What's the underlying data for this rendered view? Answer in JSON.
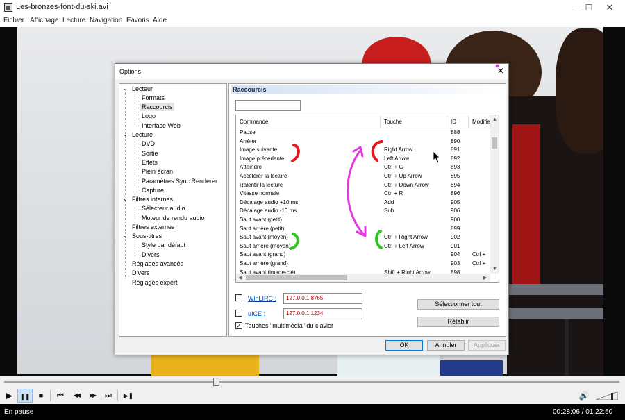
{
  "window": {
    "title": "Les-bronzes-font-du-ski.avi",
    "minimize": "–",
    "maximize": "☐",
    "close": "✕"
  },
  "menu": [
    "Fichier",
    "Affichage",
    "Lecture",
    "Navigation",
    "Favoris",
    "Aide"
  ],
  "player": {
    "seek_progress": 0.34,
    "status": "En pause",
    "time": "00:28:06 / 01:22:50"
  },
  "controls": {
    "play": "▶",
    "pause": "❚❚",
    "stop": "■",
    "prev": "⏮",
    "rewind": "◀◀",
    "forward": "▶▶",
    "next": "⏭",
    "frame_step": "▶❚",
    "volume": "🔊"
  },
  "dialog": {
    "title": "Options",
    "tree": [
      "Lecteur",
      "Formats",
      "Raccourcis",
      "Logo",
      "Interface Web",
      "Lecture",
      "DVD",
      "Sortie",
      "Effets",
      "Plein écran",
      "Paramètres Sync Renderer",
      "Capture",
      "Filtres internes",
      "Sélecteur audio",
      "Moteur de rendu audio",
      "Filtres externes",
      "Sous-titres",
      "Style par défaut",
      "Divers",
      "Réglages avancés",
      "Divers",
      "Réglages expert"
    ],
    "panel_title": "Raccourcis",
    "search_value": "",
    "columns": [
      "Commande",
      "Touche",
      "ID",
      "Modifier"
    ],
    "shortcuts": [
      [
        "Pause",
        "",
        "888",
        ""
      ],
      [
        "Arrêter",
        "",
        "890",
        ""
      ],
      [
        "Image suivante",
        "Right Arrow",
        "891",
        ""
      ],
      [
        "Image précédente",
        "Left Arrow",
        "892",
        ""
      ],
      [
        "Atteindre",
        "Ctrl + G",
        "893",
        ""
      ],
      [
        "Accélérer la lecture",
        "Ctrl + Up Arrow",
        "895",
        ""
      ],
      [
        "Ralentir la lecture",
        "Ctrl + Down Arrow",
        "894",
        ""
      ],
      [
        "Vitesse normale",
        "Ctrl + R",
        "896",
        ""
      ],
      [
        "Décalage audio +10 ms",
        "Add",
        "905",
        ""
      ],
      [
        "Décalage audio -10 ms",
        "Sub",
        "906",
        ""
      ],
      [
        "Saut avant (petit)",
        "",
        "900",
        ""
      ],
      [
        "Saut arrière (petit)",
        "",
        "899",
        ""
      ],
      [
        "Saut avant (moyen)",
        "Ctrl + Right Arrow",
        "902",
        ""
      ],
      [
        "Saut arrière (moyen)",
        "Ctrl + Left Arrow",
        "901",
        ""
      ],
      [
        "Saut avant (grand)",
        "",
        "904",
        "Ctrl +"
      ],
      [
        "Saut arrière (grand)",
        "",
        "903",
        "Ctrl +"
      ],
      [
        "Saut avant (image-clé)",
        "Shift + Right Arrow",
        "898",
        ""
      ]
    ],
    "winlirc_label": "WinLIRC :",
    "winlirc_value": "127.0.0.1:8765",
    "uice_label": "uICE :",
    "uice_value": "127.0.0.1:1234",
    "multimedia_label": "Touches \"multimédia\" du clavier",
    "select_all": "Sélectionner tout",
    "reset": "Rétablir",
    "ok": "OK",
    "cancel": "Annuler",
    "apply": "Appliquer"
  },
  "colors": {
    "annotation_red": "#e0181b",
    "annotation_green": "#2ec51e",
    "annotation_magenta": "#e23ae0",
    "accent": "#0078d7"
  }
}
